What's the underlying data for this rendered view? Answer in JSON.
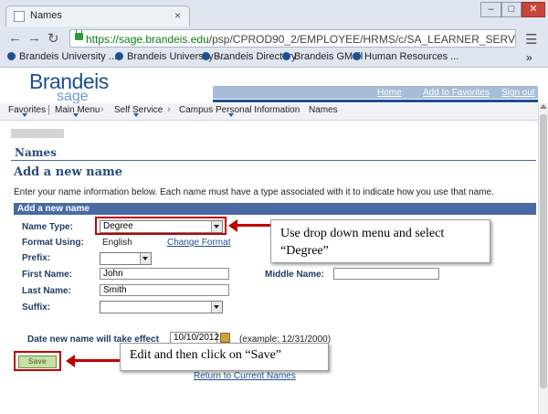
{
  "browser": {
    "tab_title": "Names",
    "url_host": "https://sage.brandeis.edu",
    "url_path": "/psp/CPROD90_2/EMPLOYEE/HRMS/c/SA_LEARNER_SERVICES.SSS_STUDEN",
    "bookmarks": [
      "Brandeis University ...",
      "Brandeis University -...",
      "Brandeis Directory",
      "Brandeis GMail",
      "Human Resources ..."
    ],
    "overflow": "»"
  },
  "header": {
    "logo_main": "Brandeis",
    "logo_sub": "sage",
    "links": [
      "Home",
      "Add to Favorites",
      "Sign out"
    ]
  },
  "breadcrumb": [
    "Favorites",
    "Main Menu",
    "Self Service",
    "Campus Personal Information",
    "Names"
  ],
  "page": {
    "section_title": "Names",
    "heading": "Add a new name",
    "instructions": "Enter your name information below. Each name must have a type associated with it to indicate how you use that name.",
    "group_header": "Add a new name"
  },
  "form": {
    "name_type_label": "Name Type:",
    "name_type_value": "Degree",
    "format_label": "Format Using:",
    "format_value": "English",
    "change_format": "Change Format",
    "prefix_label": "Prefix:",
    "prefix_value": "",
    "first_name_label": "First Name:",
    "first_name_value": "John",
    "middle_name_label": "Middle Name:",
    "middle_name_value": "",
    "last_name_label": "Last Name:",
    "last_name_value": "Smith",
    "suffix_label": "Suffix:",
    "suffix_value": "",
    "effective_label": "Date new name will take effect",
    "effective_value": "10/10/2012",
    "example": "(example: 12/31/2000)",
    "save_label": "Save",
    "return_link": "Return to Current Names"
  },
  "callouts": {
    "dropdown_note": "Use drop down menu and select “Degree”",
    "save_note": "Edit and then click on “Save”"
  },
  "colors": {
    "brand": "#1d4f91",
    "section": "#4a6aa3",
    "annotation": "#c00000",
    "save_button": "#c9dfa8"
  }
}
